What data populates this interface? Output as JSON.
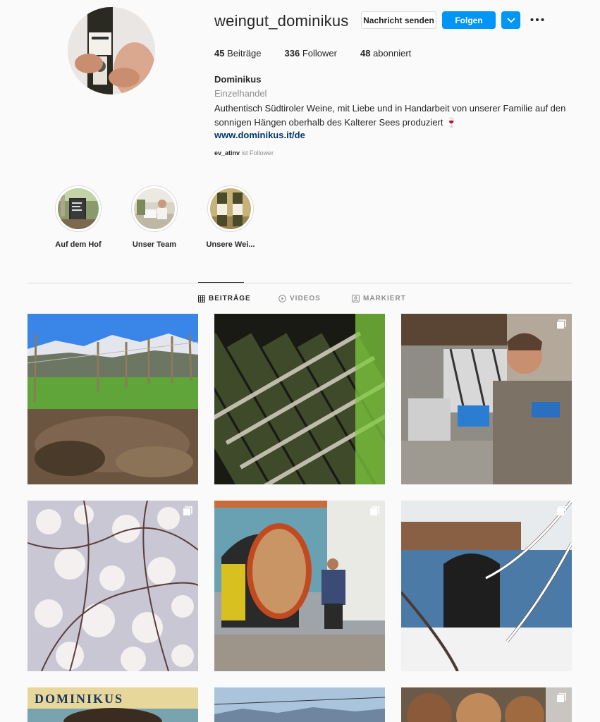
{
  "profile": {
    "username": "weingut_dominikus",
    "message_button": "Nachricht senden",
    "follow_button": "Folgen",
    "stats": {
      "posts_count": "45",
      "posts_label": "Beiträge",
      "followers_count": "336",
      "followers_label": "Follower",
      "following_count": "48",
      "following_label": "abonniert"
    },
    "full_name": "Dominikus",
    "category": "Einzelhandel",
    "bio": "Authentisch Südtiroler Weine, mit Liebe und in Handarbeit von unserer Familie auf den sonnigen Hängen oberhalb des Kalterer Sees produziert 🍷",
    "website": "www.dominikus.it/de",
    "followed_by_user": "ev_atinv",
    "followed_by_suffix": "ist Follower"
  },
  "highlights": [
    {
      "label": "Auf dem Hof"
    },
    {
      "label": "Unser Team"
    },
    {
      "label": "Unsere Wei..."
    }
  ],
  "tabs": [
    {
      "label": "BEITRÄGE",
      "icon": "grid-icon",
      "active": true
    },
    {
      "label": "VIDEOS",
      "icon": "play-circle-icon",
      "active": false
    },
    {
      "label": "MARKIERT",
      "icon": "tag-person-icon",
      "active": false
    }
  ],
  "colors": {
    "accent": "#0095f6",
    "link": "#00376b",
    "muted": "#8e8e8e",
    "border": "#dbdbdb",
    "background": "#fafafa"
  },
  "icons": [
    "chevron-down-icon",
    "more-options-icon",
    "multi-post-icon"
  ]
}
